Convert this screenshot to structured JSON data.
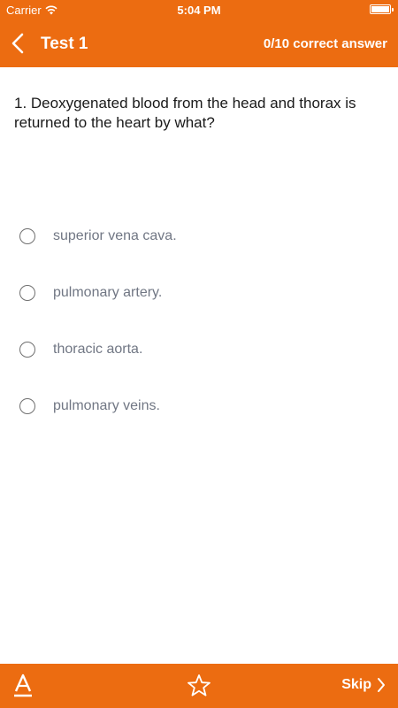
{
  "status_bar": {
    "carrier": "Carrier",
    "wifi_icon": "wifi-icon",
    "time": "5:04 PM",
    "battery_icon": "battery-icon"
  },
  "nav": {
    "back_icon": "chevron-left-icon",
    "title": "Test 1",
    "score": "0/10 correct answer"
  },
  "question": {
    "text": "1. Deoxygenated blood from the head and thorax is returned to the heart by what?"
  },
  "options": [
    {
      "label": "superior vena cava."
    },
    {
      "label": "pulmonary artery."
    },
    {
      "label": "thoracic aorta."
    },
    {
      "label": "pulmonary veins."
    }
  ],
  "bottom_bar": {
    "font_icon": "font-size-icon",
    "favorite_icon": "star-icon",
    "skip_label": "Skip",
    "skip_icon": "chevron-right-icon"
  },
  "colors": {
    "accent": "#EC6C11",
    "option_text": "#717784"
  }
}
